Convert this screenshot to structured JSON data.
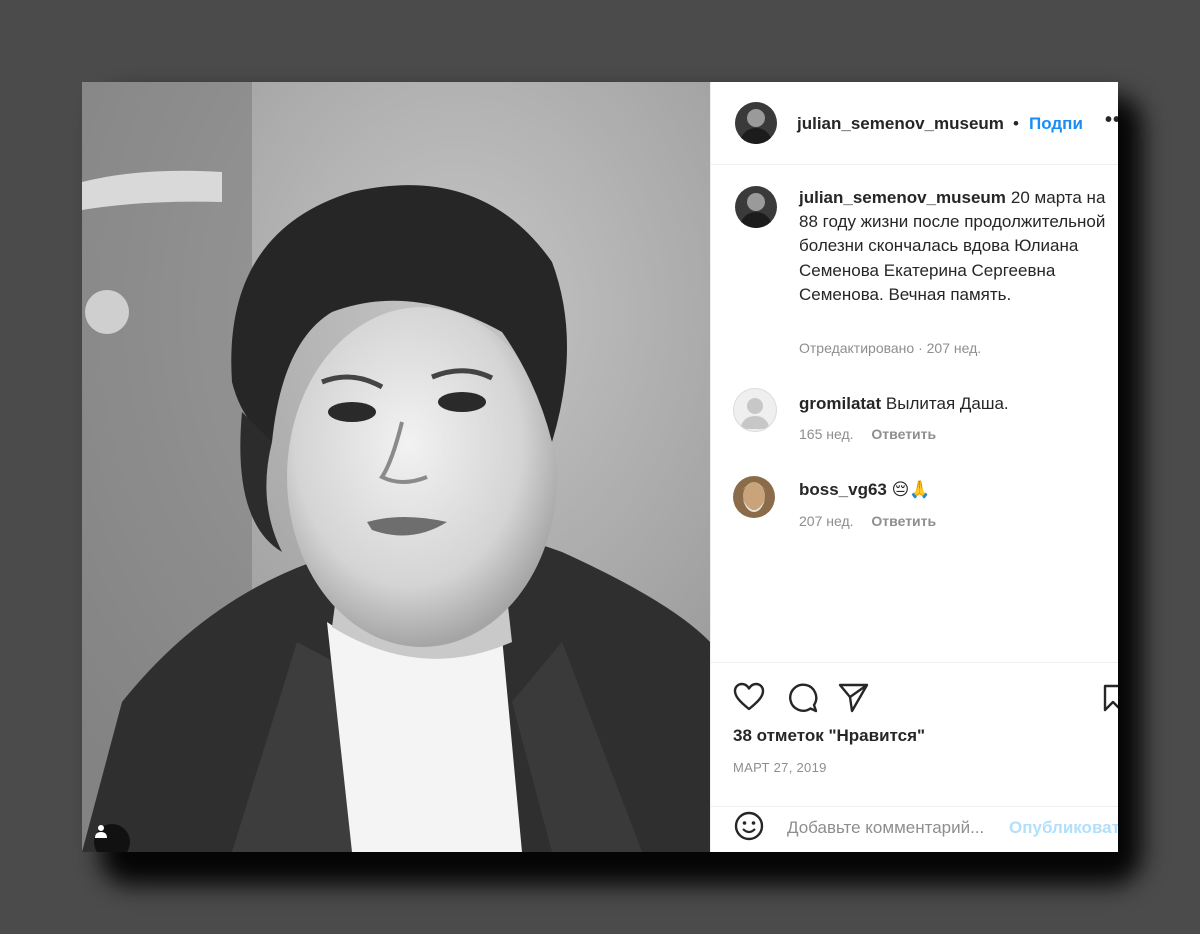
{
  "post": {
    "username": "julian_semenov_museum",
    "dot": "•",
    "follow_label": "Подпи",
    "more_label": "•••"
  },
  "caption": {
    "username": "julian_semenov_museum",
    "text": "20 марта на 88 году жизни после продолжительной болезни скончалась вдова Юлиана Семенова Екатерина Сергеевна Семенова. Вечная память.",
    "meta": "Отредактировано · 207 нед."
  },
  "comments": [
    {
      "username": "gromilatat",
      "text": "Вылитая Даша.",
      "age": "165 нед.",
      "reply_label": "Ответить"
    },
    {
      "username": "boss_vg63",
      "text": "😔🙏",
      "age": "207 нед.",
      "reply_label": "Ответить"
    }
  ],
  "actions": {
    "like_icon": "heart-icon",
    "comment_icon": "comment-icon",
    "share_icon": "send-icon",
    "save_icon": "bookmark-icon"
  },
  "likes_text": "38 отметок \"Нравится\"",
  "date_text": "МАРТ 27, 2019",
  "add_comment": {
    "placeholder": "Добавьте комментарий...",
    "publish_label": "Опубликовать"
  },
  "colors": {
    "accent": "#1a8cf5",
    "text": "#262626",
    "muted": "#8e8e8e",
    "background": "#4b4b4b"
  }
}
